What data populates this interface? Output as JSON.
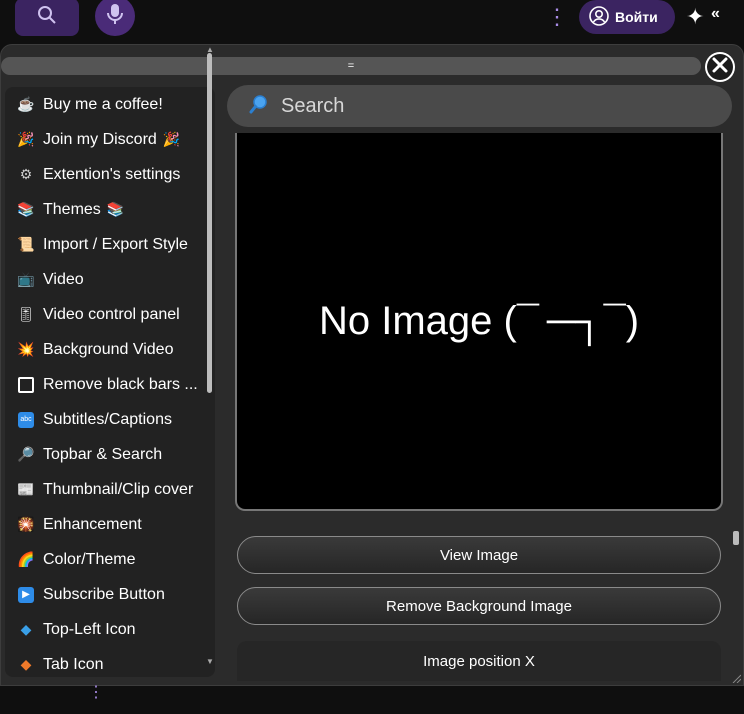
{
  "topbar": {
    "login_label": "Войти"
  },
  "panel": {
    "drag_handle": "=",
    "search": {
      "placeholder": "Search"
    },
    "image_message": "No Image (¯ ─┐¯)",
    "view_image_label": "View Image",
    "remove_bg_label": "Remove Background Image",
    "position_x_label": "Image position X"
  },
  "sidebar": {
    "items": [
      {
        "label": "Buy me a coffee!",
        "icon": "coffee-icon"
      },
      {
        "label": "Join my Discord",
        "icon": "party-icon",
        "trail": "🎉"
      },
      {
        "label": "Extention's settings",
        "icon": "gear-icon"
      },
      {
        "label": "Themes",
        "icon": "themes-icon",
        "trail": "📚"
      },
      {
        "label": "Import / Export Style",
        "icon": "scroll-icon"
      },
      {
        "label": "Video",
        "icon": "tv-icon"
      },
      {
        "label": "Video control panel",
        "icon": "control-icon"
      },
      {
        "label": "Background Video",
        "icon": "burst-icon"
      },
      {
        "label": "Remove black bars ...",
        "icon": "square-icon"
      },
      {
        "label": "Subtitles/Captions",
        "icon": "abc-icon"
      },
      {
        "label": "Topbar & Search",
        "icon": "magnifier-icon"
      },
      {
        "label": "Thumbnail/Clip cover",
        "icon": "newspaper-icon"
      },
      {
        "label": "Enhancement",
        "icon": "sparkler-icon"
      },
      {
        "label": "Color/Theme",
        "icon": "rainbow-icon"
      },
      {
        "label": "Subscribe Button",
        "icon": "play-icon"
      },
      {
        "label": "Top-Left Icon",
        "icon": "diamond-blue-icon"
      },
      {
        "label": "Tab Icon",
        "icon": "diamond-orange-icon"
      }
    ]
  },
  "colors": {
    "accent_purple": "#3b2461",
    "panel_bg": "#2b2b2b",
    "sidebar_bg": "#222222"
  }
}
